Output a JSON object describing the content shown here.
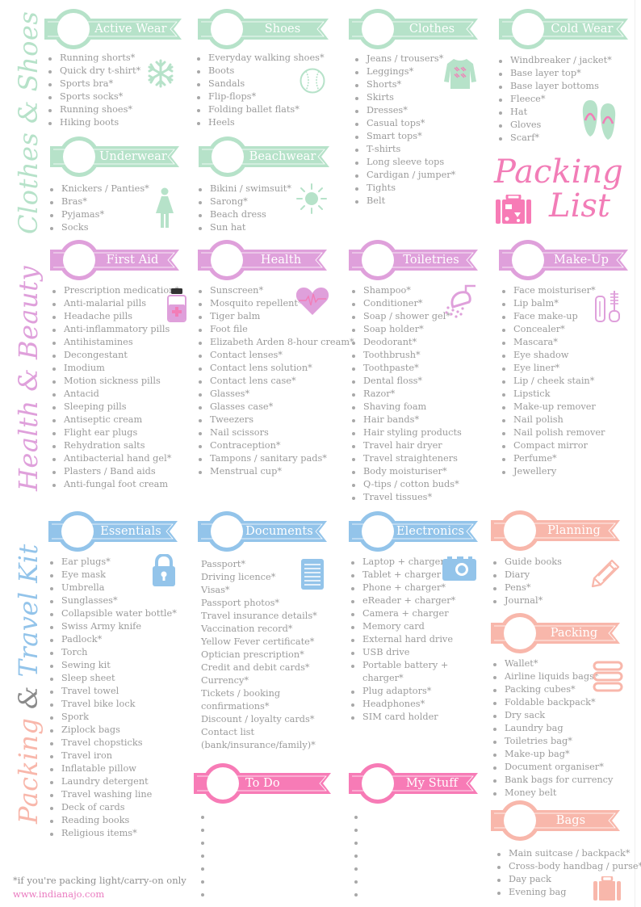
{
  "document": {
    "title_line1": "Packing",
    "title_line2": "List",
    "footnote": "*if you're packing light/carry-on only",
    "website": "www.indianajo.com"
  },
  "colors": {
    "green": "#b6e2c9",
    "purple": "#dfa0db",
    "blue": "#93c4ea",
    "coral": "#f8b7ab",
    "pink": "#f77bb6",
    "text": "#9b9b9b"
  },
  "groups": {
    "clothes_shoes": {
      "label": "Clothes & Shoes"
    },
    "health_beauty": {
      "label": "Health & Beauty"
    },
    "packing_travel": {
      "label_part1": "Packing",
      "label_amp": "&",
      "label_part2": "Travel Kit"
    }
  },
  "sections": {
    "active_wear": {
      "title": "Active Wear",
      "icon": "snowflake-icon",
      "items": [
        "Running shorts*",
        "Quick dry t-shirt*",
        "Sports bra*",
        "Sports socks*",
        "Running shoes*",
        "Hiking boots"
      ]
    },
    "shoes": {
      "title": "Shoes",
      "icon": "baseball-icon",
      "items": [
        "Everyday walking shoes*",
        "Boots",
        "Sandals",
        "Flip-flops*",
        "Folding ballet flats*",
        "Heels"
      ]
    },
    "clothes": {
      "title": "Clothes",
      "icon": "sweater-icon",
      "items": [
        "Jeans / trousers*",
        "Leggings*",
        "Shorts*",
        "Skirts",
        "Dresses*",
        "Casual tops*",
        "Smart tops*",
        "T-shirts",
        "Long sleeve tops",
        "Cardigan / jumper*",
        "Tights",
        "Belt"
      ]
    },
    "cold_wear": {
      "title": "Cold Wear",
      "icon": "flip-flops-icon",
      "items": [
        "Windbreaker / jacket*",
        "Base layer top*",
        "Base layer bottoms",
        "Fleece*",
        "Hat",
        "Gloves",
        "Scarf*"
      ]
    },
    "underwear": {
      "title": "Underwear",
      "icon": "woman-icon",
      "items": [
        "Knickers / Panties*",
        "Bras*",
        "Pyjamas*",
        "Socks"
      ]
    },
    "beachwear": {
      "title": "Beachwear",
      "icon": "sun-icon",
      "items": [
        "Bikini / swimsuit*",
        "Sarong*",
        "Beach dress",
        "Sun hat"
      ]
    },
    "first_aid": {
      "title": "First Aid",
      "icon": "medicine-bottle-icon",
      "items": [
        "Prescription medication*",
        "Anti-malarial pills",
        "Headache pills",
        "Anti-inflammatory pills",
        "Antihistamines",
        "Decongestant",
        "Imodium",
        "Motion sickness pills",
        "Antacid",
        "Sleeping pills",
        "Antiseptic cream",
        "Flight ear plugs",
        "Rehydration salts",
        "Antibacterial hand gel*",
        "Plasters / Band aids",
        "Anti-fungal foot cream"
      ]
    },
    "health": {
      "title": "Health",
      "icon": "heartbeat-icon",
      "items": [
        "Sunscreen*",
        "Mosquito repellent*",
        "Tiger balm",
        "Foot file",
        "Elizabeth Arden 8-hour cream*",
        "Contact lenses*",
        "Contact lens solution*",
        "Contact lens case*",
        "Glasses*",
        "Glasses case*",
        "Tweezers",
        "Nail scissors",
        "Contraception*",
        "Tampons / sanitary pads*",
        "Menstrual cup*"
      ]
    },
    "toiletries": {
      "title": "Toiletries",
      "icon": "shower-icon",
      "items": [
        "Shampoo*",
        "Conditioner*",
        "Soap / shower gel*",
        "Soap holder*",
        "Deodorant*",
        "Toothbrush*",
        "Toothpaste*",
        "Dental floss*",
        "Razor*",
        "Shaving foam",
        "Hair bands*",
        "Hair styling products",
        "Travel hair dryer",
        "Travel straighteners",
        "Body moisturiser*",
        "Q-tips / cotton buds*",
        "Travel tissues*"
      ]
    },
    "make_up": {
      "title": "Make-Up",
      "icon": "mascara-icon",
      "items": [
        "Face moisturiser*",
        "Lip balm*",
        "Face make-up",
        "Concealer*",
        "Mascara*",
        "Eye shadow",
        "Eye liner*",
        "Lip / cheek stain*",
        "Lipstick",
        "Make-up remover",
        "Nail polish",
        "Nail polish remover",
        "Compact mirror",
        "Perfume*",
        "Jewellery"
      ]
    },
    "essentials": {
      "title": "Essentials",
      "icon": "padlock-icon",
      "items": [
        "Ear plugs*",
        "Eye mask",
        "Umbrella",
        "Sunglasses*",
        "Collapsible water bottle*",
        "Swiss Army knife",
        "Padlock*",
        "Torch",
        "Sewing kit",
        "Sleep sheet",
        "Travel towel",
        "Travel bike lock",
        "Spork",
        "Ziplock bags",
        "Travel chopsticks",
        "Travel iron",
        "Inflatable pillow",
        "Laundry detergent",
        "Travel washing line",
        "Deck of cards",
        "Reading books",
        "Religious items*"
      ]
    },
    "documents": {
      "title": "Documents",
      "icon": "document-icon",
      "items": [
        "Passport*",
        "Driving licence*",
        "Visas*",
        "Passport photos*",
        "Travel insurance details*",
        "Vaccination record*",
        "Yellow Fever certificate*",
        "Optician prescription*",
        "Credit and debit cards*",
        "Currency*",
        "Tickets / booking confirmations*",
        "Discount / loyalty  cards*",
        "Contact list (bank/insurance/family)*"
      ]
    },
    "electronics": {
      "title": "Electronics",
      "icon": "camera-icon",
      "items": [
        "Laptop + charger",
        "Tablet + charger",
        "Phone + charger*",
        "eReader + charger*",
        "Camera + charger",
        "Memory card",
        "External hard drive",
        "USB drive",
        "Portable battery + charger*",
        "Plug adaptors*",
        "Headphones*",
        "SIM card holder"
      ]
    },
    "planning": {
      "title": "Planning",
      "icon": "pencil-icon",
      "items": [
        "Guide books",
        "Diary",
        "Pens*",
        "Journal*"
      ]
    },
    "packing": {
      "title": "Packing",
      "icon": "stacked-bags-icon",
      "items": [
        "Wallet*",
        "Airline liquids bags*",
        "Packing cubes*",
        "Foldable backpack*",
        "Dry sack",
        "Laundry bag",
        "Toiletries bag*",
        "Make-up bag*",
        "Document organiser*",
        "Bank bags for currency",
        "Money belt"
      ]
    },
    "bags": {
      "title": "Bags",
      "icon": "suitcase-icon",
      "items": [
        "Main suitcase / backpack*",
        "Cross-body handbag / purse*",
        "Day pack",
        "Evening bag"
      ]
    },
    "to_do": {
      "title": "To Do",
      "items": [
        "",
        "",
        "",
        "",
        "",
        "",
        ""
      ]
    },
    "my_stuff": {
      "title": "My Stuff",
      "items": [
        "",
        "",
        "",
        "",
        "",
        "",
        ""
      ]
    }
  }
}
